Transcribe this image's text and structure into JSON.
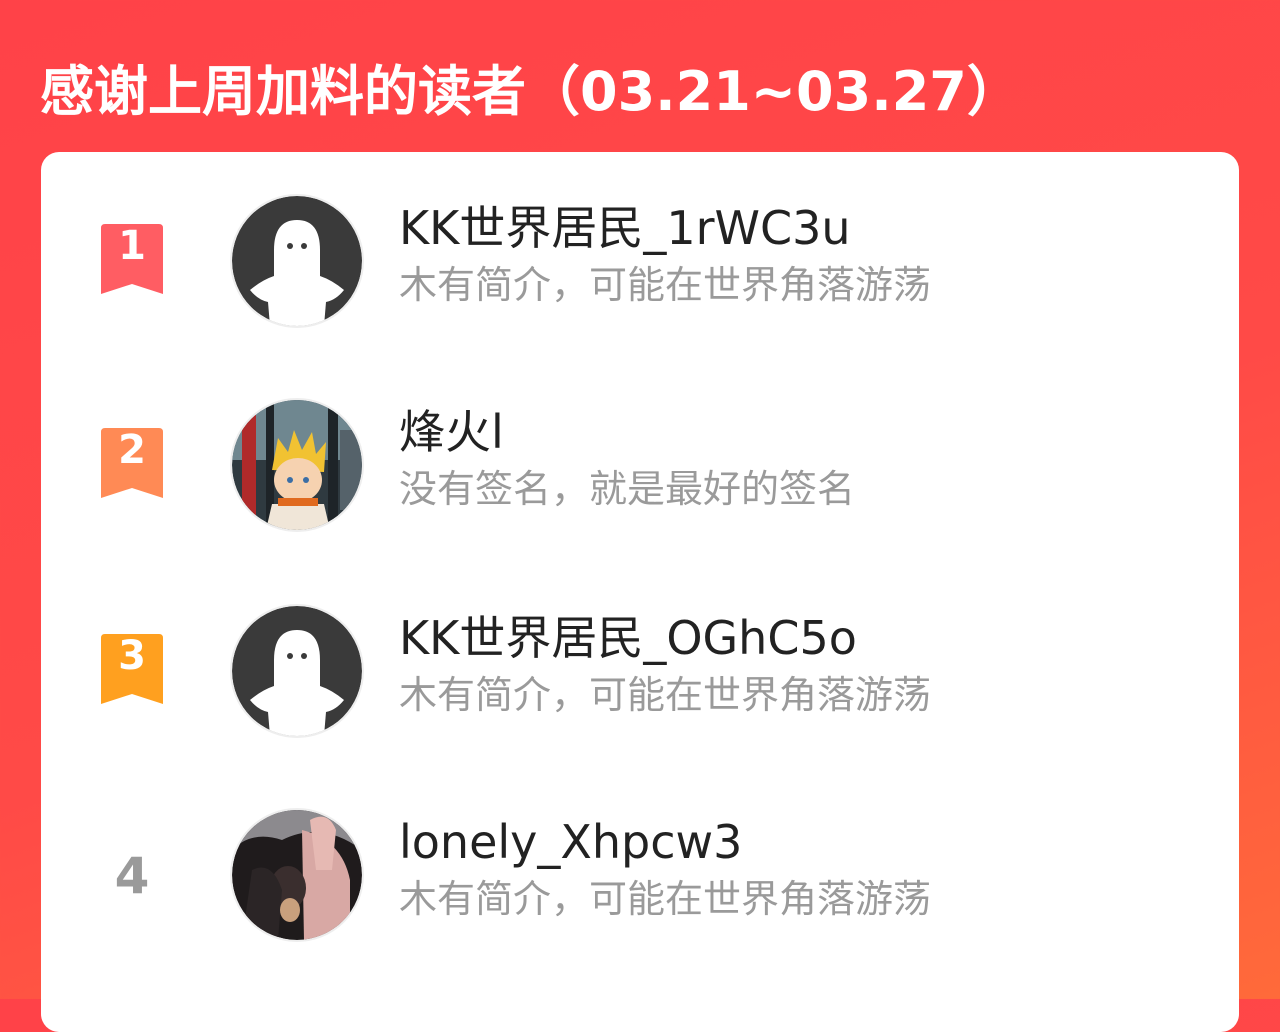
{
  "header": {
    "title": "感谢上周加料的读者（03.21~03.27）"
  },
  "colors": {
    "background": "#ff4248",
    "rank1": "#ff5a60",
    "rank2": "#ff8a52",
    "rank3": "#ffa322",
    "plain_rank": "#9a9a9a",
    "name": "#222222",
    "bio": "#9a9a9a"
  },
  "readers": [
    {
      "rank": "1",
      "name": "KK世界居民_1rWC3u",
      "bio": "木有简介，可能在世界角落游荡",
      "avatar": "default-ghost-avatar"
    },
    {
      "rank": "2",
      "name": "烽火l",
      "bio": "没有签名，就是最好的签名",
      "avatar": "anime-character-avatar"
    },
    {
      "rank": "3",
      "name": "KK世界居民_OGhC5o",
      "bio": "木有简介，可能在世界角落游荡",
      "avatar": "default-ghost-avatar"
    },
    {
      "rank": "4",
      "name": "lonely_Xhpcw3",
      "bio": "木有简介，可能在世界角落游荡",
      "avatar": "photo-avatar"
    }
  ]
}
